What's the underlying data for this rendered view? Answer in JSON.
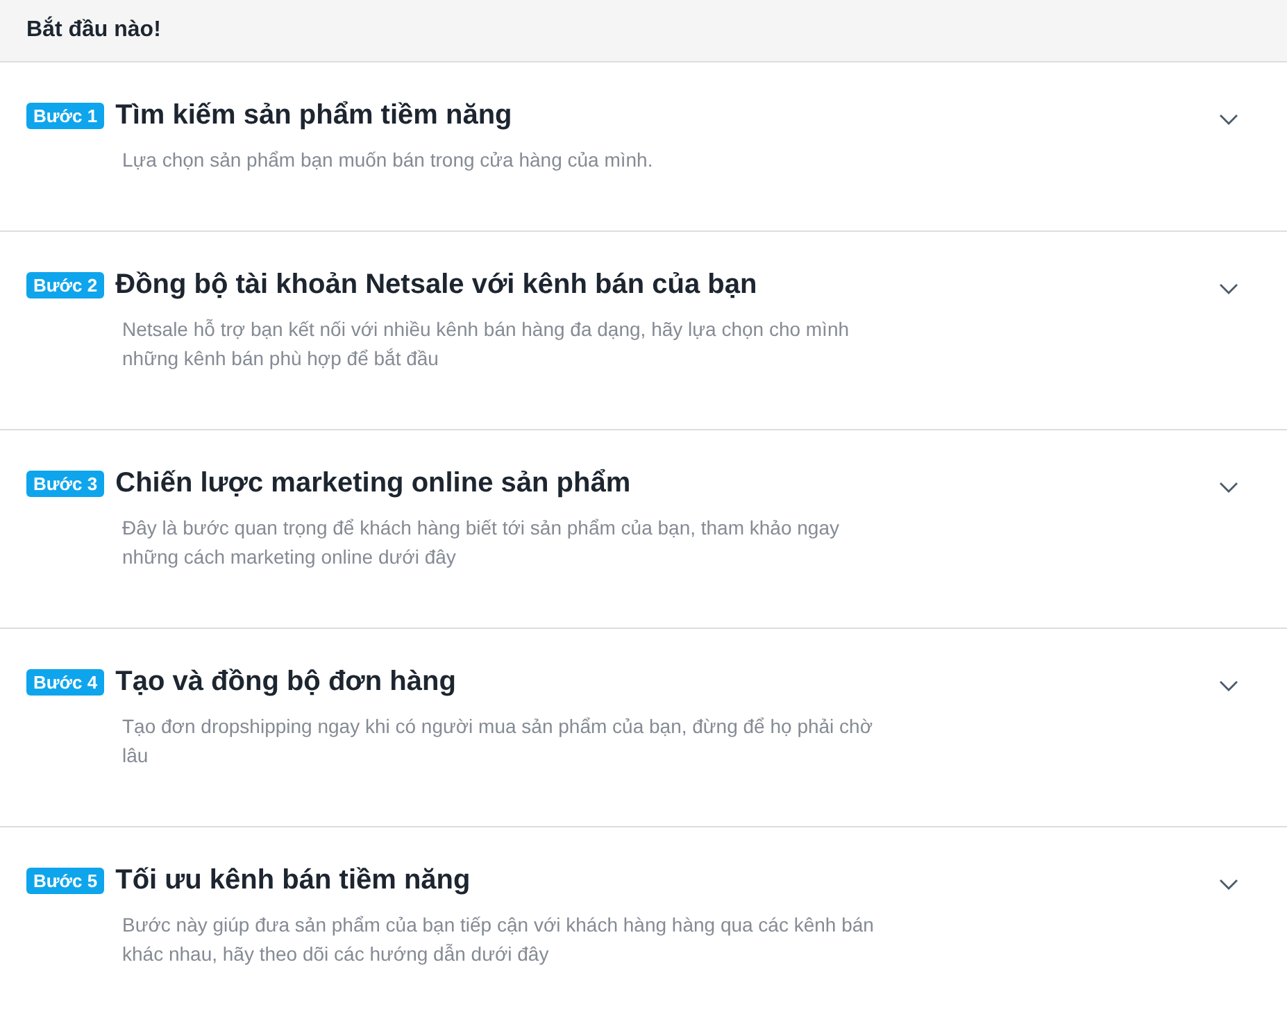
{
  "header": {
    "title": "Bắt đầu nào!"
  },
  "steps": [
    {
      "badge": "Bước 1",
      "title": "Tìm kiếm sản phẩm tiềm năng",
      "description": "Lựa chọn sản phẩm bạn muốn bán trong cửa hàng của mình.",
      "expanded": false
    },
    {
      "badge": "Bước 2",
      "title": "Đồng bộ tài khoản Netsale với kênh bán của bạn",
      "description": "Netsale hỗ trợ bạn kết nối với nhiều kênh bán hàng đa dạng, hãy lựa chọn cho mình những kênh bán phù hợp để bắt đầu",
      "expanded": false
    },
    {
      "badge": "Bước 3",
      "title": "Chiến lược marketing online sản phẩm",
      "description": "Đây là bước quan trọng để khách hàng biết tới sản phẩm của bạn, tham khảo ngay những cách marketing online dưới đây",
      "expanded": false
    },
    {
      "badge": "Bước 4",
      "title": "Tạo và đồng bộ đơn hàng",
      "description": "Tạo đơn dropshipping ngay khi có người mua sản phẩm của bạn, đừng để họ phải chờ lâu",
      "expanded": false
    },
    {
      "badge": "Bước 5",
      "title": "Tối ưu kênh bán tiềm năng",
      "description": "Bước này giúp đưa sản phẩm của bạn tiếp cận với khách hàng hàng qua các kênh bán khác nhau, hãy theo dõi các hướng dẫn dưới đây",
      "expanded": false
    }
  ]
}
